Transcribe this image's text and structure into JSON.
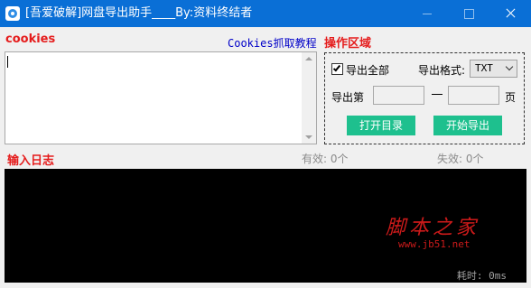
{
  "window": {
    "title": "[吾爱破解]网盘导出助手____By:资料终结者"
  },
  "cookies": {
    "label": "cookies",
    "tutorial_link": "Cookies抓取教程",
    "value": ""
  },
  "operations": {
    "label": "操作区域",
    "export_all_label": "导出全部",
    "export_all_checked": true,
    "format_label": "导出格式:",
    "format_value": "TXT",
    "page_label": "导出第",
    "page_from": "",
    "page_dash": "—",
    "page_to": "",
    "page_unit": "页",
    "open_dir_button": "打开目录",
    "start_export_button": "开始导出"
  },
  "log": {
    "label": "输入日志",
    "valid": "有效: 0个",
    "invalid": "失效: 0个",
    "elapsed": "耗时: 0ms"
  },
  "watermark": {
    "text": "脚本之家",
    "url": "www.jb51.net"
  },
  "colors": {
    "titlebar": "#0a6fd6",
    "label_red": "#e51c1c",
    "button_green": "#1ec08e",
    "link_blue": "#0000c8",
    "log_bg": "#000000"
  },
  "icons": [
    "app-icon",
    "minimize-icon",
    "maximize-icon",
    "close-icon",
    "checkbox-check-icon",
    "chevron-down-icon",
    "scroll-up-icon",
    "scroll-down-icon"
  ]
}
